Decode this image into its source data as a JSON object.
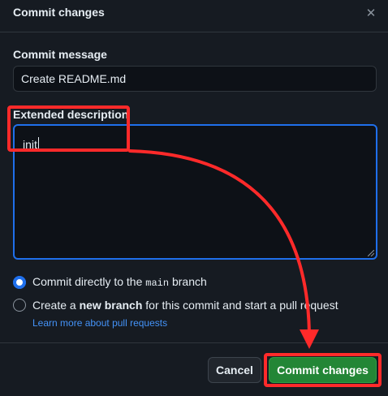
{
  "dialog": {
    "title": "Commit changes",
    "close_icon": "close-icon"
  },
  "commit_message": {
    "label": "Commit message",
    "value": "Create README.md"
  },
  "extended_description": {
    "label": "Extended description",
    "value": "init"
  },
  "branch_options": {
    "direct": {
      "prefix": "Commit directly to the ",
      "branch": "main",
      "suffix": " branch",
      "checked": true
    },
    "new_branch": {
      "prefix": "Create a ",
      "bold": "new branch",
      "suffix": " for this commit and start a pull request",
      "checked": false
    },
    "learn_more": "Learn more about pull requests"
  },
  "footer": {
    "cancel_label": "Cancel",
    "commit_label": "Commit changes"
  },
  "colors": {
    "background": "#161b22",
    "accent_blue": "#1f6feb",
    "commit_green": "#238636",
    "annotation_red": "#ff2a2a"
  }
}
